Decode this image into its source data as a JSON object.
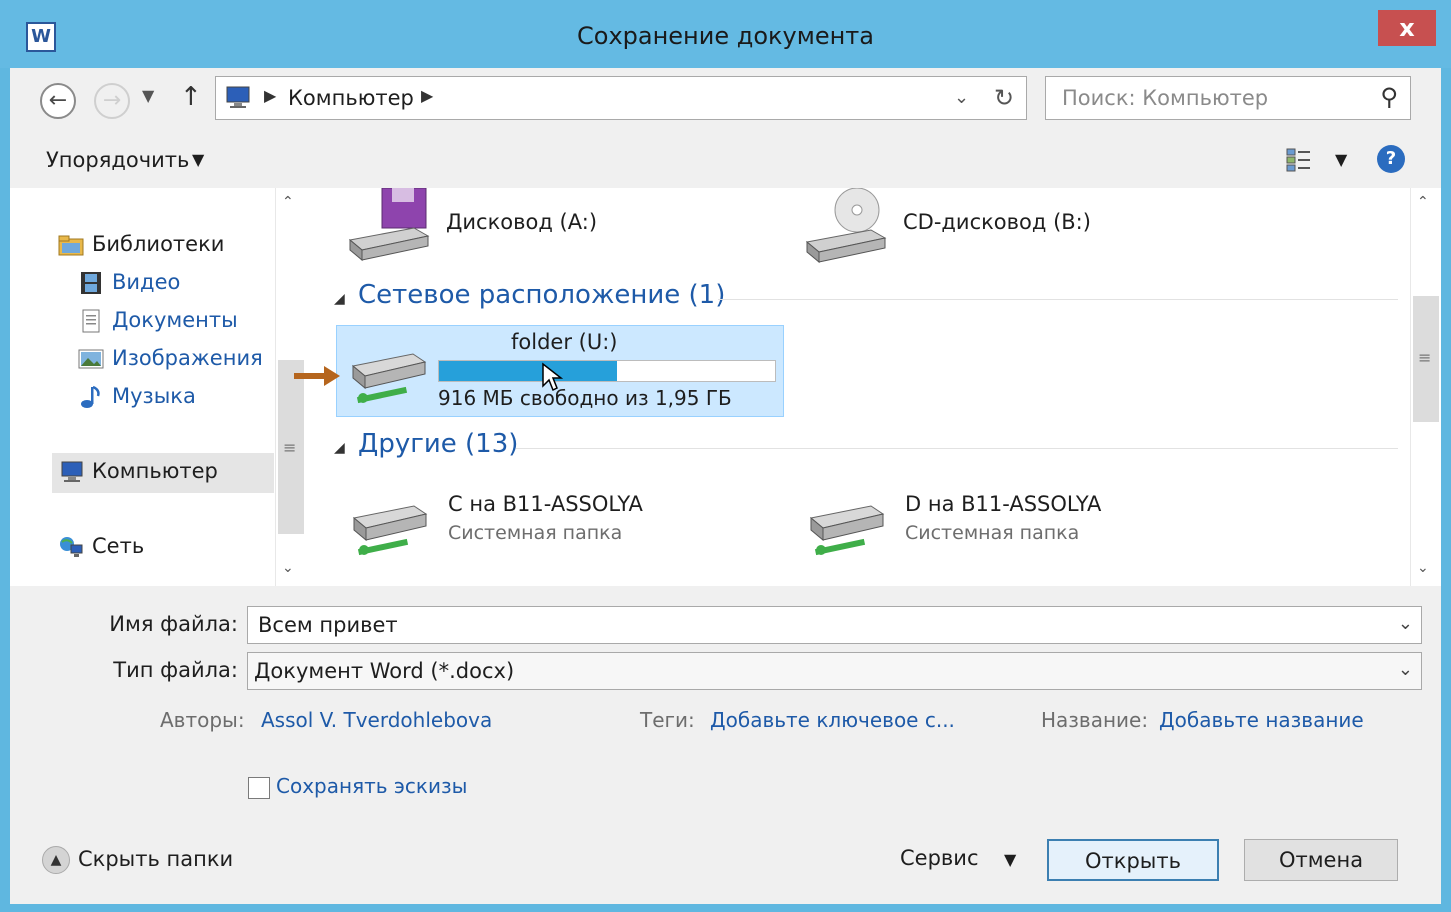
{
  "window": {
    "title": "Сохранение документа",
    "app_icon_letter": "W",
    "close_glyph": "x"
  },
  "navigation": {
    "address_segment": "Компьютер",
    "search_placeholder": "Поиск: Компьютер"
  },
  "toolbar": {
    "organize_label": "Упорядочить"
  },
  "sidebar": {
    "libraries": "Библиотеки",
    "items": [
      {
        "label": "Видео",
        "icon": "video-icon"
      },
      {
        "label": "Документы",
        "icon": "documents-icon"
      },
      {
        "label": "Изображения",
        "icon": "images-icon"
      },
      {
        "label": "Музыка",
        "icon": "music-icon"
      }
    ],
    "computer": "Компьютер",
    "network": "Сеть"
  },
  "content": {
    "top_drives": [
      {
        "name": "Дисковод (A:)",
        "icon": "floppy-drive-icon"
      },
      {
        "name": "CD-дисковод (B:)",
        "icon": "cd-drive-icon"
      }
    ],
    "network_group": {
      "header": "Сетевое расположение (1)",
      "drive_name": "folder (U:)",
      "drive_caption": "916 МБ свободно из 1,95 ГБ",
      "used_fraction": 0.53
    },
    "other_group": {
      "header": "Другие (13)",
      "items": [
        {
          "name": "C на B11-ASSOLYA",
          "caption": "Системная папка"
        },
        {
          "name": "D на B11-ASSOLYA",
          "caption": "Системная папка"
        }
      ]
    }
  },
  "form": {
    "filename_label": "Имя файла:",
    "filename_value": "Всем привет",
    "filetype_label": "Тип файла:",
    "filetype_value": "Документ Word (*.docx)",
    "authors_label": "Авторы:",
    "authors_value": "Assol V. Tverdohlebova",
    "tags_label": "Теги:",
    "tags_value": "Добавьте ключевое с...",
    "title_label": "Название:",
    "title_value": "Добавьте название",
    "thumbnails_label": "Сохранять эскизы"
  },
  "footer": {
    "hide_folders": "Скрыть папки",
    "service": "Сервис",
    "open": "Открыть",
    "cancel": "Отмена"
  },
  "colors": {
    "title_bar": "#64bae3",
    "link_blue": "#1e5aa8",
    "selection": "#cce8ff",
    "progress": "#26a0da",
    "marker_arrow": "#b5651d"
  }
}
